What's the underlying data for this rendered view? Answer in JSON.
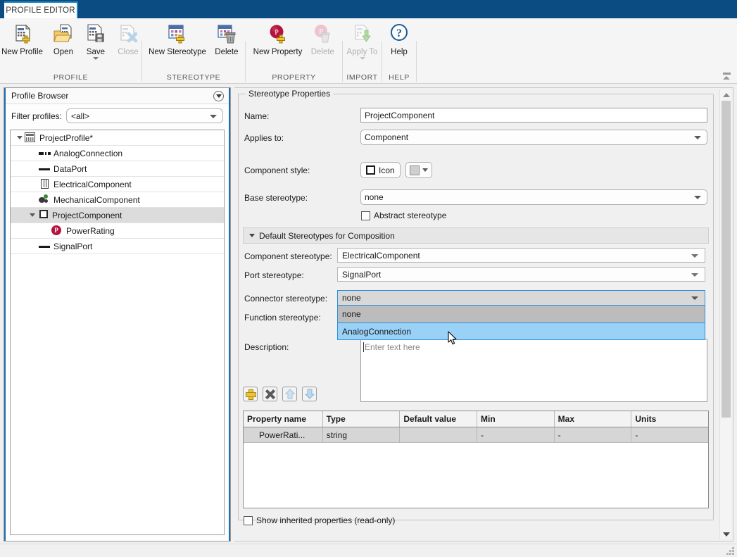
{
  "window": {
    "tab_label": "PROFILE EDITOR"
  },
  "ribbon": {
    "groups": [
      {
        "title": "PROFILE",
        "buttons": [
          {
            "label": "New Profile",
            "icon": "new-profile-icon",
            "disabled": false,
            "has_caret": false
          },
          {
            "label": "Open",
            "icon": "open-folder-icon",
            "disabled": false,
            "has_caret": false
          },
          {
            "label": "Save",
            "icon": "save-icon",
            "disabled": false,
            "has_caret": true
          },
          {
            "label": "Close",
            "icon": "close-profile-icon",
            "disabled": true,
            "has_caret": false
          }
        ]
      },
      {
        "title": "STEREOTYPE",
        "buttons": [
          {
            "label": "New Stereotype",
            "icon": "new-stereotype-icon",
            "disabled": false,
            "has_caret": false
          },
          {
            "label": "Delete",
            "icon": "delete-stereotype-icon",
            "disabled": false,
            "has_caret": false
          }
        ]
      },
      {
        "title": "PROPERTY",
        "buttons": [
          {
            "label": "New Property",
            "icon": "new-property-icon",
            "disabled": false,
            "has_caret": false
          },
          {
            "label": "Delete",
            "icon": "delete-property-icon",
            "disabled": true,
            "has_caret": false
          }
        ]
      },
      {
        "title": "IMPORT",
        "buttons": [
          {
            "label": "Apply To",
            "icon": "apply-to-icon",
            "disabled": true,
            "has_caret": true
          }
        ]
      },
      {
        "title": "HELP",
        "buttons": [
          {
            "label": "Help",
            "icon": "help-icon",
            "disabled": false,
            "has_caret": false
          }
        ]
      }
    ]
  },
  "browser": {
    "title": "Profile Browser",
    "filter_label": "Filter profiles:",
    "filter_value": "<all>",
    "tree": [
      {
        "label": "ProjectProfile*",
        "icon": "profile-icon",
        "indent": 0,
        "twisty": "open",
        "selected": false
      },
      {
        "label": "AnalogConnection",
        "icon": "dashed-connector-icon",
        "indent": 1,
        "twisty": "none",
        "selected": false
      },
      {
        "label": "DataPort",
        "icon": "solid-line-icon",
        "indent": 1,
        "twisty": "none",
        "selected": false
      },
      {
        "label": "ElectricalComponent",
        "icon": "chip-icon",
        "indent": 1,
        "twisty": "none",
        "selected": false
      },
      {
        "label": "MechanicalComponent",
        "icon": "mechanical-icon",
        "indent": 1,
        "twisty": "none",
        "selected": false
      },
      {
        "label": "ProjectComponent",
        "icon": "square-icon",
        "indent": 1,
        "twisty": "open",
        "selected": true
      },
      {
        "label": "PowerRating",
        "icon": "property-icon",
        "indent": 2,
        "twisty": "none",
        "selected": false
      },
      {
        "label": "SignalPort",
        "icon": "solid-line-icon",
        "indent": 1,
        "twisty": "none",
        "selected": false
      }
    ]
  },
  "properties": {
    "group_title": "Stereotype Properties",
    "name_label": "Name:",
    "name_value": "ProjectComponent",
    "applies_label": "Applies to:",
    "applies_value": "Component",
    "style_label": "Component style:",
    "style_icon_label": "Icon",
    "base_label": "Base stereotype:",
    "base_value": "none",
    "abstract_label": "Abstract stereotype",
    "section_title": "Default Stereotypes for Composition",
    "component_stereotype_label": "Component stereotype:",
    "component_stereotype_value": "ElectricalComponent",
    "port_stereotype_label": "Port stereotype:",
    "port_stereotype_value": "SignalPort",
    "connector_stereotype_label": "Connector stereotype:",
    "connector_stereotype_value": "none",
    "function_stereotype_label": "Function stereotype:",
    "description_label": "Description:",
    "description_placeholder": "Enter text here",
    "dropdown_open": {
      "items": [
        "none",
        "AnalogConnection"
      ],
      "highlighted": "AnalogConnection"
    },
    "toolbar_buttons": [
      {
        "name": "add-property-button",
        "icon": "plus-icon",
        "disabled": false
      },
      {
        "name": "remove-property-button",
        "icon": "x-icon",
        "disabled": false
      },
      {
        "name": "move-up-button",
        "icon": "arrow-up-icon",
        "disabled": true
      },
      {
        "name": "move-down-button",
        "icon": "arrow-down-icon",
        "disabled": true
      }
    ],
    "table": {
      "columns": [
        "Property name",
        "Type",
        "Default value",
        "Min",
        "Max",
        "Units"
      ],
      "rows": [
        [
          "PowerRati...",
          "string",
          "",
          "-",
          "-",
          "-"
        ]
      ]
    },
    "show_inherited_label": "Show inherited properties (read-only)"
  },
  "colors": {
    "title_bar": "#0b4d82",
    "tab_accent": "#1f8ac0",
    "selection_blue": "#99d1f7",
    "focus_border": "#2f8fd8",
    "property_badge": "#b5123c"
  }
}
